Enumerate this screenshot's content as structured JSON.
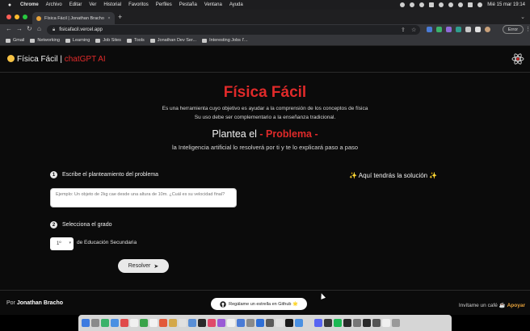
{
  "menubar": {
    "app": "Chrome",
    "items": [
      "Archivo",
      "Editar",
      "Ver",
      "Historial",
      "Favoritos",
      "Perfiles",
      "Pestaña",
      "Ventana",
      "Ayuda"
    ],
    "clock": "Mié 15 mar  19:14"
  },
  "browser": {
    "tab_title": "Física Fácil | Jonathan Bracho",
    "tab_close": "×",
    "new_tab": "+",
    "tab_chevron": "⌄",
    "back": "←",
    "forward": "→",
    "reload": "↻",
    "home": "⌂",
    "url": "fisicafacil.vercel.app",
    "error_button": "Error",
    "menu_glyph": "⋮",
    "bookmarks": [
      "Gmail",
      "Networking",
      "Learning",
      "Job Sites",
      "Tools",
      "Jonathan Dev Ser...",
      "Interesting Jobs I'..."
    ]
  },
  "app": {
    "brand": "Física Fácil | ",
    "brand_accent": "chatGPT AI",
    "title": "Física Fácil",
    "description_1": "Es una herramienta cuyo objetivo es ayudar a la comprensión de los conceptos de física",
    "description_2": "Su uso debe ser complementario a la enseñanza tradicional.",
    "plantea_prefix": "Plantea el ",
    "plantea_accent": "- Problema -",
    "plantea_sub": "la Inteligencia artificial lo resolverá por ti y te lo explicará paso a paso",
    "step1_num": "1",
    "step1_label": "Escribe el planteamiento del problema",
    "problem_placeholder": "Ejemplo: Un objeto de 2kg cae desde una altura de 10m. ¿Cuál es su velocidad final?",
    "solution_label": "✨ Aquí tendrás la solución ✨",
    "step2_num": "2",
    "step2_label": "Selecciona el grado",
    "grade_value": "1º",
    "grade_suffix": "de Educación Secundaria",
    "resolve_label": "Resolver",
    "resolve_arrow": "➤"
  },
  "footer": {
    "author_prefix": "Por ",
    "author_name": "Jonathan Bracho",
    "github_label": "Regálame un estrella en Github 🌟",
    "coffee_label": "Invítame un café ☕ ",
    "coffee_link": "Apoyar"
  },
  "colors": {
    "accent": "#e02a2a",
    "background": "#0b0b0b",
    "coffee": "#e8a33b"
  }
}
